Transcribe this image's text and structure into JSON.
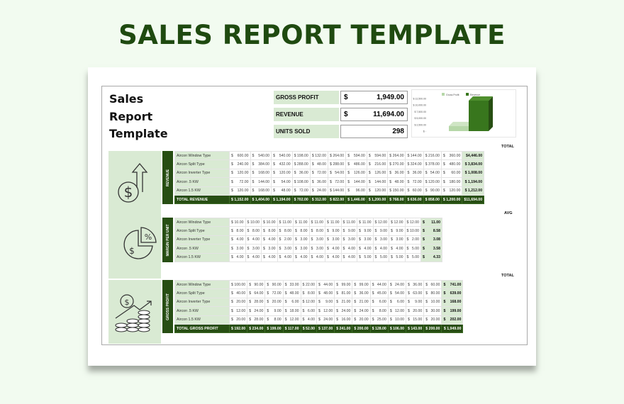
{
  "page_title": "SALES REPORT TEMPLATE",
  "document": {
    "title_lines": [
      "Sales",
      "Report",
      "Template"
    ],
    "kpis": [
      {
        "label": "GROSS PROFIT",
        "currency": "$",
        "value": "1,949.00"
      },
      {
        "label": "REVENUE",
        "currency": "$",
        "value": "11,694.00"
      },
      {
        "label": "UNITS SOLD",
        "currency": "",
        "value": "298"
      }
    ],
    "chart": {
      "legend": [
        "Gross Profit",
        "Revenue"
      ],
      "yticks": [
        "$ 12,500.00",
        "$ 10,000.00",
        "$ 7,500.00",
        "$ 5,000.00",
        "$ 2,500.00",
        "$ -"
      ],
      "ymax": 12500,
      "values": [
        1949,
        11694
      ],
      "colors": [
        "#b6d7a8",
        "#38761d"
      ]
    },
    "sections": [
      {
        "label": "REVENUE",
        "icon": "dollar-growth-icon",
        "summary_header": "TOTAL",
        "rows": [
          {
            "name": "Aircon Window Type",
            "values": [
              "600.00",
              "540.00",
              "540.00",
              "198.00",
              "132.00",
              "264.00",
              "594.00",
              "594.00",
              "264.00",
              "144.00",
              "216.00",
              "360.00"
            ],
            "summary": "$4,446.00"
          },
          {
            "name": "Aircon Split Type",
            "values": [
              "240.00",
              "384.00",
              "432.00",
              "288.00",
              "48.00",
              "288.00",
              "486.00",
              "216.00",
              "270.00",
              "324.00",
              "378.00",
              "480.00"
            ],
            "summary": "$ 3,834.00"
          },
          {
            "name": "Aircon Inverter Type",
            "values": [
              "120.00",
              "168.00",
              "120.00",
              "36.00",
              "72.00",
              "54.00",
              "126.00",
              "126.00",
              "36.00",
              "36.00",
              "54.00",
              "60.00"
            ],
            "summary": "$ 1,008.00"
          },
          {
            "name": "Aircon .5 KW",
            "values": [
              "72.00",
              "144.00",
              "54.00",
              "108.00",
              "36.00",
              "72.00",
              "144.00",
              "144.00",
              "48.00",
              "72.00",
              "120.00",
              "180.00"
            ],
            "summary": "$ 1,194.00"
          },
          {
            "name": "Aircon 1.5 KW",
            "values": [
              "120.00",
              "168.00",
              "48.00",
              "72.00",
              "24.00",
              "144.00",
              "96.00",
              "120.00",
              "150.00",
              "60.00",
              "90.00",
              "120.00"
            ],
            "summary": "$ 1,212.00"
          }
        ],
        "total": {
          "name": "TOTAL REVENUE",
          "values": [
            "$ 1,152.00",
            "$ 1,404.00",
            "$ 1,194.00",
            "$ 702.00",
            "$ 312.00",
            "$ 822.00",
            "$ 1,446.00",
            "$ 1,200.00",
            "$ 768.00",
            "$ 636.00",
            "$ 858.00",
            "$ 1,200.00"
          ],
          "summary": "$11,694.00"
        }
      },
      {
        "label": "MARGIN PER UNIT",
        "icon": "pie-percent-icon",
        "summary_header": "AVG",
        "rows": [
          {
            "name": "Aircon Window Type",
            "values": [
              "10.00",
              "10.00",
              "10.00",
              "11.00",
              "11.00",
              "11.00",
              "11.00",
              "11.00",
              "11.00",
              "12.00",
              "12.00",
              "12.00"
            ],
            "summary": "11.00"
          },
          {
            "name": "Aircon Split Type",
            "values": [
              "8.00",
              "8.00",
              "8.00",
              "8.00",
              "8.00",
              "8.00",
              "9.00",
              "9.00",
              "9.00",
              "9.00",
              "9.00",
              "10.00"
            ],
            "summary": "8.58"
          },
          {
            "name": "Aircon Inverter Type",
            "values": [
              "4.00",
              "4.00",
              "4.00",
              "2.00",
              "3.00",
              "3.00",
              "3.00",
              "3.00",
              "3.00",
              "3.00",
              "3.00",
              "2.00"
            ],
            "summary": "3.08"
          },
          {
            "name": "Aircon .5 KW",
            "values": [
              "3.00",
              "3.00",
              "3.00",
              "3.00",
              "3.00",
              "3.00",
              "4.00",
              "4.00",
              "4.00",
              "4.00",
              "4.00",
              "5.00"
            ],
            "summary": "3.58"
          },
          {
            "name": "Aircon 1.5 KW",
            "values": [
              "4.00",
              "4.00",
              "4.00",
              "4.00",
              "4.00",
              "4.00",
              "4.00",
              "4.00",
              "5.00",
              "5.00",
              "5.00",
              "5.00"
            ],
            "summary": "4.33"
          }
        ]
      },
      {
        "label": "GROSS PROFIT",
        "icon": "coins-growth-icon",
        "summary_header": "TOTAL",
        "rows": [
          {
            "name": "Aircon Window Type",
            "values": [
              "100.00",
              "90.00",
              "90.00",
              "33.00",
              "22.00",
              "44.00",
              "99.00",
              "99.00",
              "44.00",
              "24.00",
              "36.00",
              "60.00"
            ],
            "summary": "741.00"
          },
          {
            "name": "Aircon Split Type",
            "values": [
              "40.00",
              "64.00",
              "72.00",
              "48.00",
              "8.00",
              "48.00",
              "81.00",
              "36.00",
              "45.00",
              "54.00",
              "63.00",
              "80.00"
            ],
            "summary": "639.00"
          },
          {
            "name": "Aircon Inverter Type",
            "values": [
              "20.00",
              "28.00",
              "20.00",
              "6.00",
              "12.00",
              "9.00",
              "21.00",
              "21.00",
              "6.00",
              "6.00",
              "9.00",
              "10.00"
            ],
            "summary": "168.00"
          },
          {
            "name": "Aircon .5 KW",
            "values": [
              "12.00",
              "24.00",
              "9.00",
              "18.00",
              "6.00",
              "12.00",
              "24.00",
              "24.00",
              "8.00",
              "12.00",
              "20.00",
              "30.00"
            ],
            "summary": "199.00"
          },
          {
            "name": "Aircon 1.5 KW",
            "values": [
              "20.00",
              "28.00",
              "8.00",
              "12.00",
              "4.00",
              "24.00",
              "16.00",
              "20.00",
              "25.00",
              "10.00",
              "15.00",
              "20.00"
            ],
            "summary": "202.00"
          }
        ],
        "total": {
          "name": "TOTAL GROSS PROFIT",
          "values": [
            "$ 192.00",
            "$ 234.00",
            "$ 199.00",
            "$ 117.00",
            "$ 52.00",
            "$ 137.00",
            "$ 241.00",
            "$ 200.00",
            "$ 128.00",
            "$ 106.00",
            "$ 143.00",
            "$ 200.00"
          ],
          "summary": "$ 1,949.00"
        }
      }
    ]
  }
}
